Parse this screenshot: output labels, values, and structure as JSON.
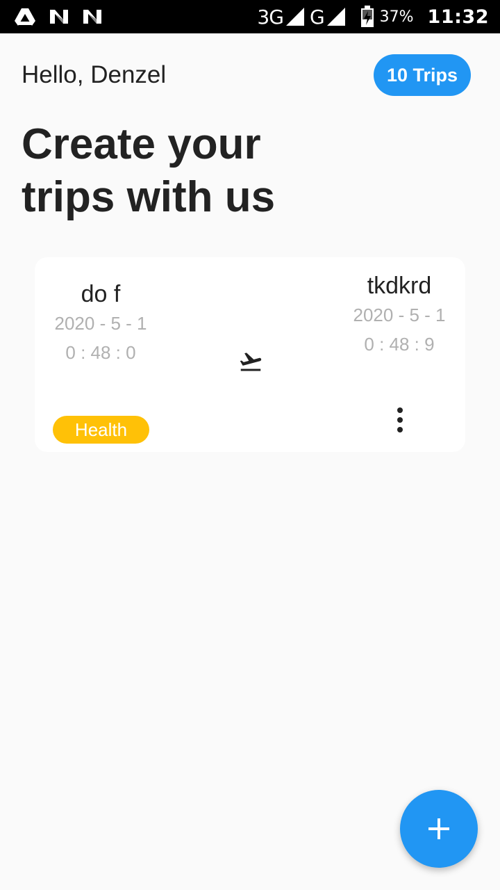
{
  "status_bar": {
    "icons_left": [
      "drive-icon",
      "n-notification-icon",
      "n-notification-icon"
    ],
    "network_1": "3G",
    "network_2": "G",
    "battery_percent": "37%",
    "time": "11:32"
  },
  "header": {
    "greeting": "Hello, Denzel",
    "trips_count_label": "10 Trips",
    "headline_line1": "Create your",
    "headline_line2": "trips with us"
  },
  "trips": [
    {
      "from": {
        "city": "do f",
        "date": "2020 - 5 - 1",
        "time": "0 : 48 : 0"
      },
      "to": {
        "city": "tkdkrd",
        "date": "2020 - 5 - 1",
        "time": "0 : 48 : 9"
      },
      "icon": "flight-takeoff-icon",
      "category": "Health",
      "category_color": "#ffc107"
    }
  ],
  "fab": {
    "icon": "plus-icon"
  },
  "colors": {
    "accent": "#2196f3",
    "background": "#fafafa",
    "card": "#ffffff",
    "muted_text": "#b0b0b0"
  }
}
